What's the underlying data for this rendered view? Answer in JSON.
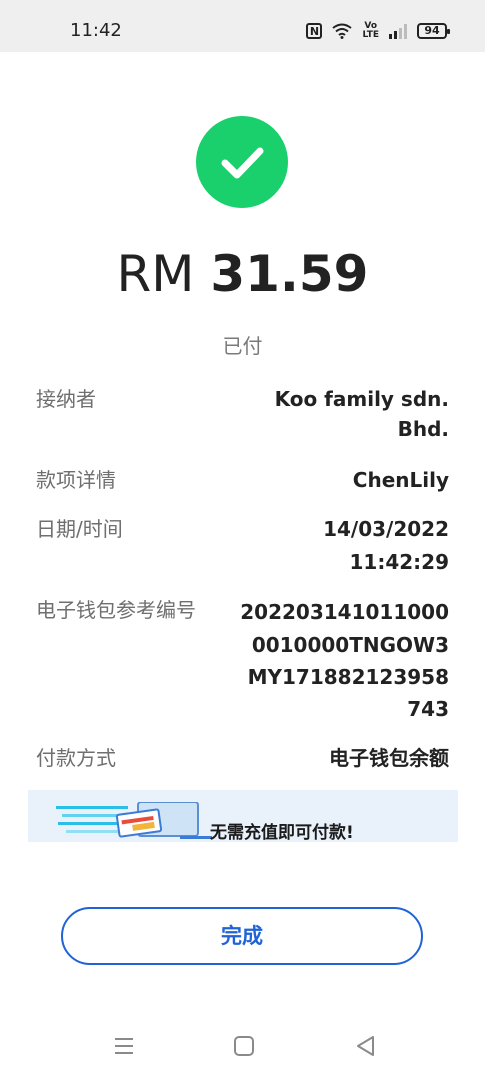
{
  "status_bar": {
    "time": "11:42",
    "nfc": "N",
    "volte_top": "Vo",
    "volte_bottom": "LTE",
    "battery": "94",
    "icons": [
      "nfc-icon",
      "wifi-icon",
      "volte-icon",
      "signal-icon",
      "battery-icon"
    ]
  },
  "payment": {
    "status_icon": "check-icon",
    "currency": "RM",
    "amount": "31.59",
    "status": "已付",
    "accent": "#19d06c"
  },
  "details": {
    "recipient_label": "接纳者",
    "recipient_value": "Koo family sdn. Bhd.",
    "details_label": "款项详情",
    "details_value": "ChenLily",
    "datetime_label": "日期/时间",
    "date": "14/03/2022",
    "time": "11:42:29",
    "reference_label": "电子钱包参考编号",
    "reference_lines": [
      "202203141011000",
      "0010000TNGOW3",
      "MY171882123958",
      "743"
    ],
    "method_label": "付款方式",
    "method_value": "电子钱包余额"
  },
  "banner": {
    "text": "无需充值即可付款!",
    "background": "#e9f1fb"
  },
  "actions": {
    "done_label": "完成",
    "accent": "#1f63d6"
  },
  "nav": {
    "icons": [
      "menu-icon",
      "home-icon",
      "back-icon"
    ]
  }
}
